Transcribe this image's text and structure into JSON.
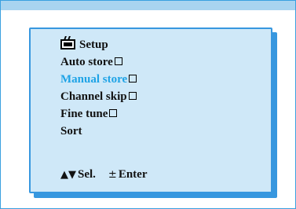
{
  "menu": {
    "title": "Setup",
    "title_icon": "tv-icon",
    "items": [
      {
        "label": "Auto store",
        "has_box": true,
        "active": false
      },
      {
        "label": "Manual store",
        "has_box": true,
        "active": true
      },
      {
        "label": "Channel skip",
        "has_box": true,
        "active": false
      },
      {
        "label": "Fine tune",
        "has_box": true,
        "active": false
      },
      {
        "label": "Sort",
        "has_box": false,
        "active": false
      }
    ],
    "active_color": "#1ea3e6",
    "panel_color": "#cfe8f8",
    "border_color": "#3797df"
  },
  "hints": {
    "select_icon": "up-down-arrow-icon",
    "select_glyph": "▲▼",
    "select_label": "Sel.",
    "enter_icon": "plus-minus-icon",
    "enter_glyph": "±",
    "enter_label": "Enter"
  }
}
